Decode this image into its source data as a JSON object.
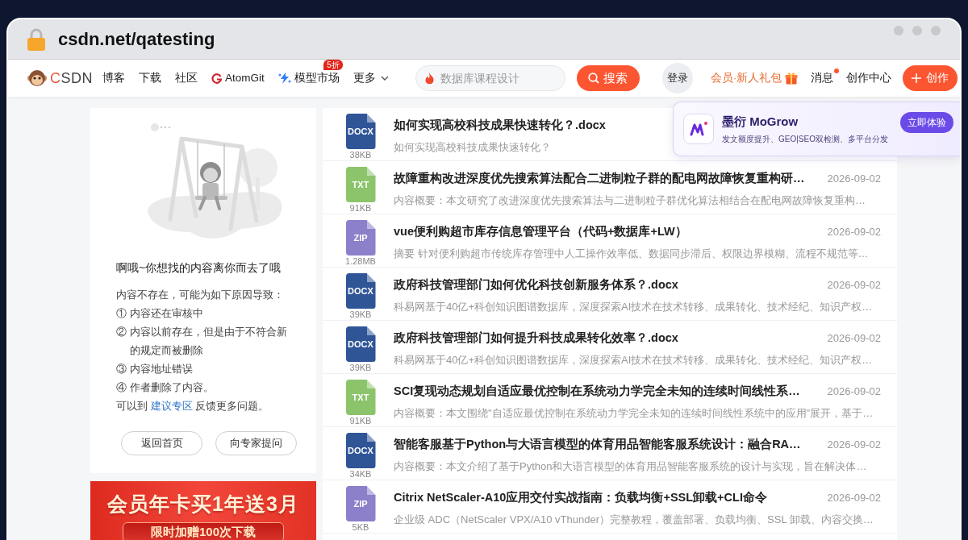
{
  "browser": {
    "url": "csdn.net/qatesting"
  },
  "nav": {
    "logo": "CSDN",
    "links": [
      {
        "label": "博客",
        "kind": "plain"
      },
      {
        "label": "下载",
        "kind": "plain"
      },
      {
        "label": "社区",
        "kind": "plain"
      },
      {
        "label": "AtomGit",
        "kind": "g-logo"
      },
      {
        "label": "模型市场",
        "kind": "sparkle",
        "badge": "5折"
      },
      {
        "label": "更多",
        "kind": "dropdown"
      }
    ],
    "search": {
      "placeholder": "数据库课程设计",
      "button": "搜索"
    },
    "login": "登录",
    "vip": "会员·新人礼包",
    "messages": {
      "label": "消息",
      "unread": true
    },
    "creator_center": "创作中心",
    "create_button": "创作"
  },
  "popup": {
    "title": "墨衍 MoGrow",
    "subtitle": "发文额度提升、GEO|SEO双检测、多平台分发",
    "button": "立即体验"
  },
  "not_found": {
    "title": "啊哦~你想找的内容离你而去了哦",
    "intro": "内容不存在，可能为如下原因导致：",
    "reasons": [
      "① 内容还在审核中",
      "② 内容以前存在，但是由于不符合新的规定而被删除",
      "③ 内容地址错误",
      "④ 作者删除了内容。"
    ],
    "footer": {
      "before": "可以到",
      "link": "建议专区",
      "after": "反馈更多问题。"
    },
    "buttons": [
      "返回首页",
      "向专家提问"
    ]
  },
  "banner": {
    "title": "会员年卡买1年送3月",
    "offer": "限时加赠100次下载"
  },
  "resources": [
    {
      "type": "DOCX",
      "color": "#2f5597",
      "size": "38KB",
      "title": "如何实现高校科技成果快速转化？.docx",
      "summary": "如何实现高校科技成果快速转化？"
    },
    {
      "type": "TXT",
      "color": "#8cc46c",
      "size": "91KB",
      "title": "故障重构改进深度优先搜索算法配合二进制粒子群的配电网故障恢复重构研…",
      "summary": "内容概要：本文研究了改进深度优先搜索算法与二进制粒子群优化算法相结合在配电网故障恢复重构…",
      "date": "2026-09-02"
    },
    {
      "type": "ZIP",
      "color": "#8b80c9",
      "size": "1.28MB",
      "title": "vue便利购超市库存信息管理平台（代码+数据库+LW）",
      "summary": "摘要 针对便利购超市传统库存管理中人工操作效率低、数据同步滞后、权限边界模糊、流程不规范等…",
      "date": "2026-09-02"
    },
    {
      "type": "DOCX",
      "color": "#2f5597",
      "size": "39KB",
      "title": "政府科技管理部门如何优化科技创新服务体系？.docx",
      "summary": "科易网基于40亿+科创知识图谱数据库，深度探索AI技术在技术转移、成果转化、技术经纪、知识产权…",
      "date": "2026-09-02"
    },
    {
      "type": "DOCX",
      "color": "#2f5597",
      "size": "39KB",
      "title": "政府科技管理部门如何提升科技成果转化效率？.docx",
      "summary": "科易网基于40亿+科创知识图谱数据库，深度探索AI技术在技术转移、成果转化、技术经纪、知识产权…",
      "date": "2026-09-02"
    },
    {
      "type": "TXT",
      "color": "#8cc46c",
      "size": "91KB",
      "title": "SCI复现动态规划自适应最优控制在系统动力学完全未知的连续时间线性系…",
      "summary": "内容概要：本文围绕\"自适应最优控制在系统动力学完全未知的连续时间线性系统中的应用\"展开，基于…",
      "date": "2026-09-02"
    },
    {
      "type": "DOCX",
      "color": "#2f5597",
      "size": "34KB",
      "title": "智能客服基于Python与大语言模型的体育用品智能客服系统设计：融合RA…",
      "summary": "内容概要：本文介绍了基于Python和大语言模型的体育用品智能客服系统的设计与实现，旨在解决体…",
      "date": "2026-09-02"
    },
    {
      "type": "ZIP",
      "color": "#8b80c9",
      "size": "5KB",
      "title": "Citrix NetScaler-A10应用交付实战指南：负载均衡+SSL卸载+CLI命令",
      "summary": "企业级 ADC（NetScaler VPX/A10 vThunder）完整教程，覆盖部署、负载均衡、SSL 卸载、内容交换…",
      "date": "2026-09-02"
    }
  ]
}
